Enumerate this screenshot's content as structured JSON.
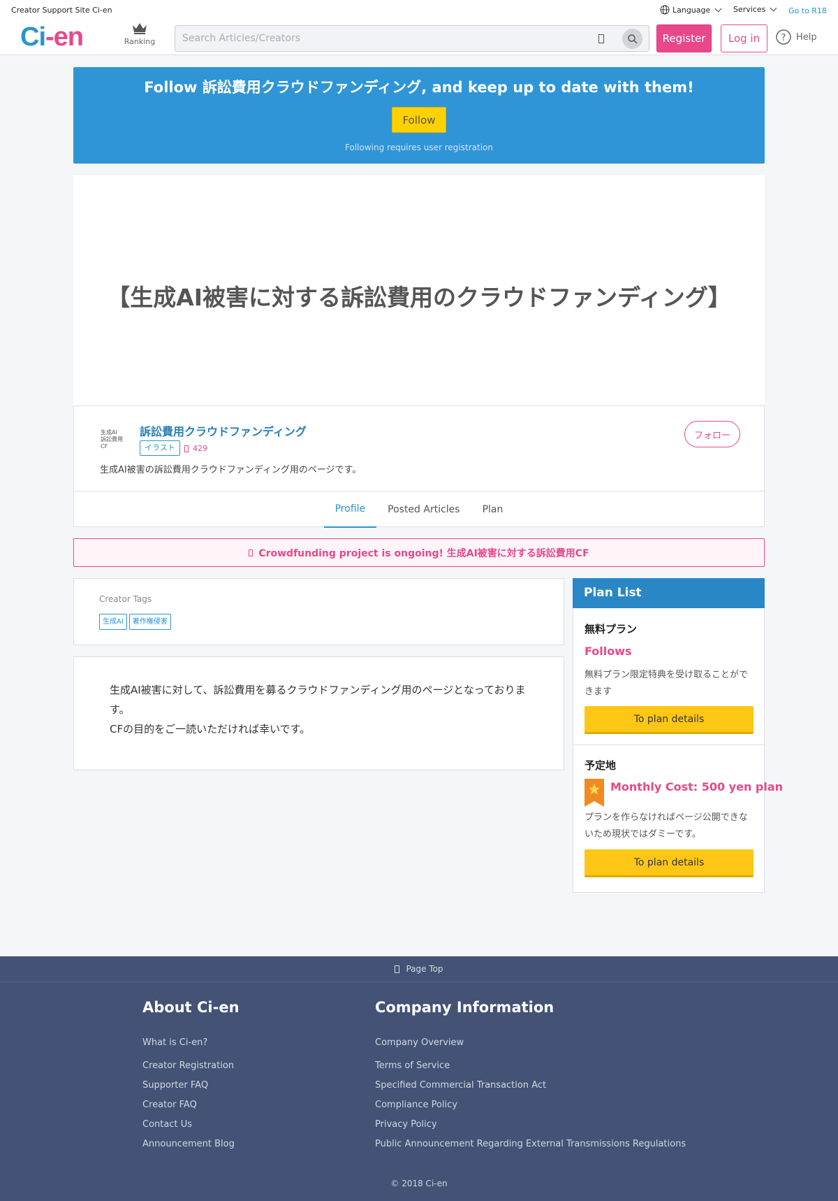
{
  "header": {
    "site_label": "Creator Support Site Ci-en",
    "logo_main": "Ci",
    "logo_dash": "-",
    "logo_tail": "en",
    "ranking_label": "Ranking",
    "search_placeholder": "Search Articles/Creators",
    "language_label": "Language",
    "services_label": "Services",
    "r18_label": "Go to R18",
    "register_label": "Register",
    "login_label": "Log in",
    "help_label": "Help"
  },
  "banner": {
    "title": "Follow 訴訟費用クラウドファンディング, and keep up to date with them!",
    "follow_label": "Follow",
    "note": "Following requires user registration"
  },
  "hero": {
    "title": "【生成AI被害に対する訴訟費用のクラウドファンディング】"
  },
  "creator": {
    "avatar_text": "生成AI\n訴訟費用\nCF",
    "name": "訴訟費用クラウドファンディング",
    "category": "イラスト",
    "count": "429",
    "description": "生成AI被害の訴訟費用クラウドファンディング用のページです。",
    "follow_label": "フォロー",
    "tabs": [
      "Profile",
      "Posted Articles",
      "Plan"
    ]
  },
  "notice": {
    "text": "Crowdfunding project is ongoing! 生成AI被害に対する訴訟費用CF"
  },
  "tags": {
    "label": "Creator Tags",
    "items": [
      "生成AI",
      "著作権侵害"
    ]
  },
  "body": {
    "line1": "生成AI被害に対して、訴訟費用を募るクラウドファンディング用のページとなっております。",
    "line2": "CFの目的をご一読いただければ幸いです。"
  },
  "plans": {
    "heading": "Plan List",
    "items": [
      {
        "name": "無料プラン",
        "subtitle": "Follows",
        "description": "無料プラン限定特典を受け取ることができます",
        "button": "To plan details"
      },
      {
        "name": "予定地",
        "subtitle": "Monthly Cost: 500 yen plan",
        "description": "プランを作らなければページ公開できないため現状ではダミーです。",
        "button": "To plan details"
      }
    ]
  },
  "footer": {
    "page_top": "Page Top",
    "about_heading": "About Ci-en",
    "about_links": [
      "What is Ci-en?",
      "Creator Registration",
      "Supporter FAQ",
      "Creator FAQ",
      "Contact Us",
      "Announcement Blog"
    ],
    "company_heading": "Company Information",
    "company_links": [
      "Company Overview",
      "Terms of Service",
      "Specified Commercial Transaction Act",
      "Compliance Policy",
      "Privacy Policy",
      "Public Announcement Regarding External Transmissions Regulations"
    ],
    "copyright": "© 2018 Ci-en"
  },
  "colors": {
    "brand_blue": "#2a93d0",
    "brand_pink": "#e8488a",
    "banner_blue": "#2f95d6",
    "plan_yellow": "#ffc715",
    "footer_navy": "#435275"
  },
  "icons": [
    "crown-icon",
    "search-icon",
    "globe-icon",
    "help-icon",
    "star-badge-icon"
  ]
}
